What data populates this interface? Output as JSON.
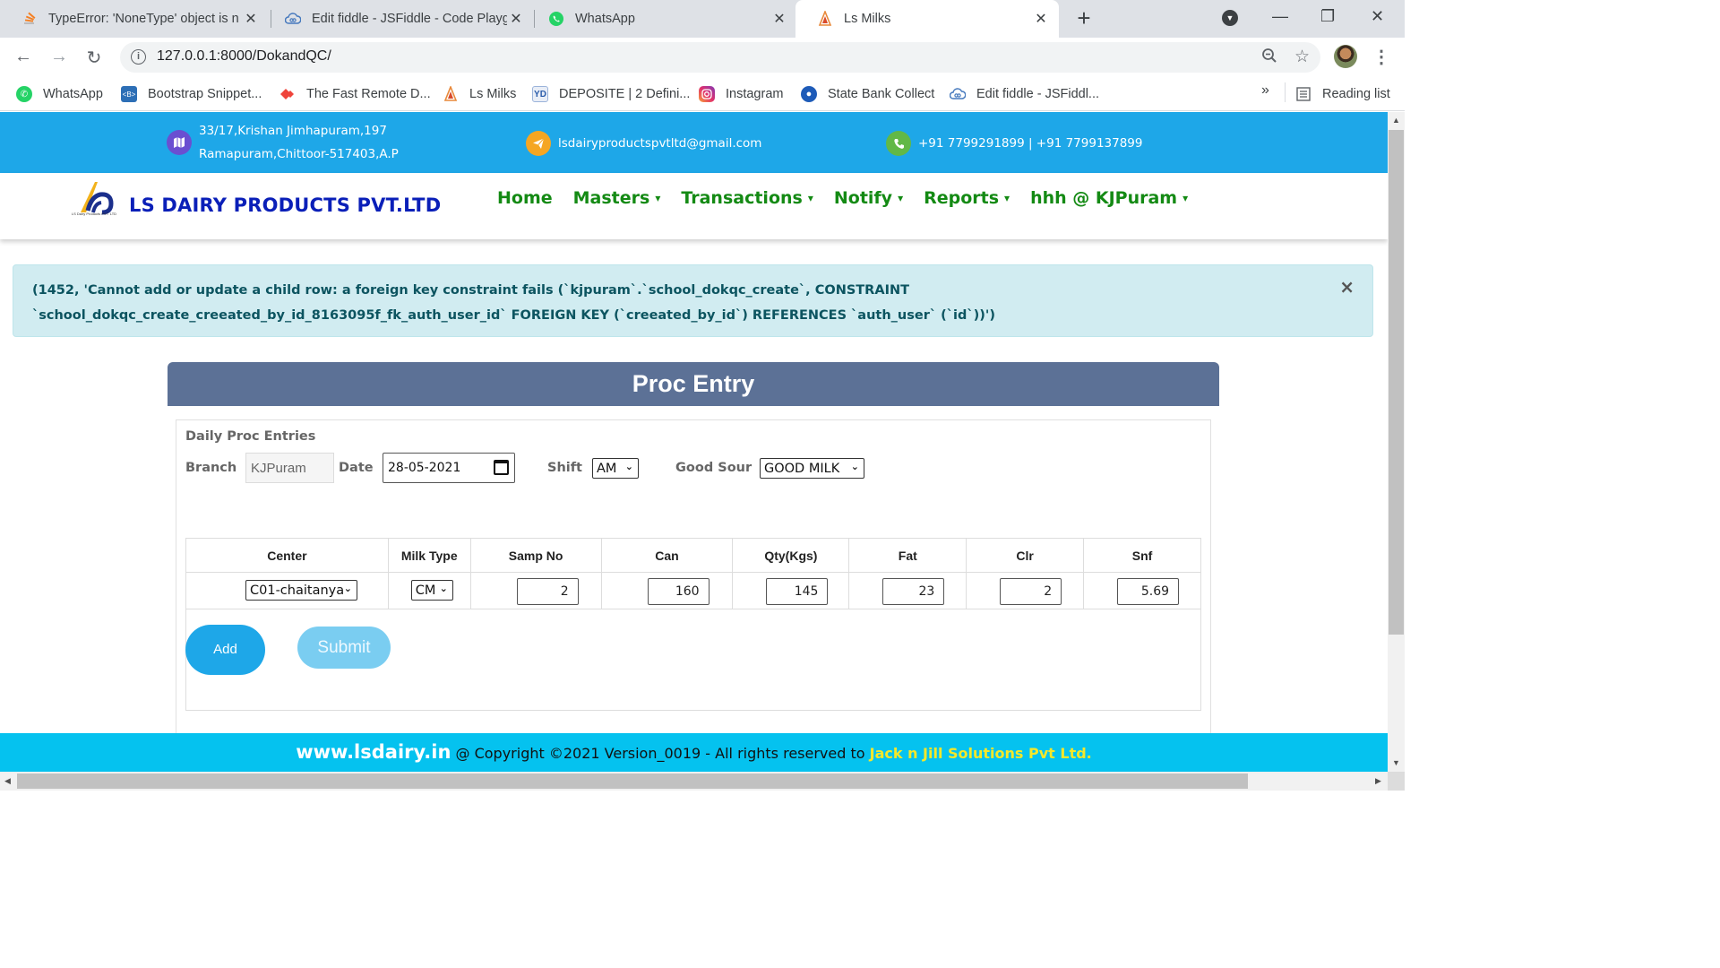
{
  "browser": {
    "tabs": [
      {
        "title": "TypeError: 'NoneType' object is n",
        "icon": "stackoverflow-icon"
      },
      {
        "title": "Edit fiddle - JSFiddle - Code Playg",
        "icon": "jsfiddle-icon"
      },
      {
        "title": "WhatsApp",
        "icon": "whatsapp-icon"
      },
      {
        "title": "Ls Milks",
        "icon": "ls-milks-icon"
      }
    ],
    "close_glyph": "✕",
    "new_tab_glyph": "+",
    "url": "127.0.0.1:8000/DokandQC/",
    "bookmarks": [
      {
        "label": "WhatsApp",
        "icon": "whatsapp-icon"
      },
      {
        "label": "Bootstrap Snippet...",
        "icon": "bootstrap-icon"
      },
      {
        "label": "The Fast Remote D...",
        "icon": "anydesk-icon"
      },
      {
        "label": "Ls Milks",
        "icon": "ls-milks-icon"
      },
      {
        "label": "DEPOSITE | 2 Defini...",
        "icon": "youdao-icon"
      },
      {
        "label": "Instagram",
        "icon": "instagram-icon"
      },
      {
        "label": "State Bank Collect",
        "icon": "sbi-icon"
      },
      {
        "label": "Edit fiddle - JSFiddl...",
        "icon": "jsfiddle-icon"
      }
    ],
    "more_bookmarks": "»",
    "reading_list": "Reading list"
  },
  "contact_bar": {
    "address_line1": "33/17,Krishan Jimhapuram,197",
    "address_line2": "Ramapuram,Chittoor-517403,A.P",
    "email": "lsdairyproductspvtltd@gmail.com",
    "phone": "+91 7799291899 | +91 7799137899"
  },
  "navbar": {
    "brand": "LS DAIRY PRODUCTS PVT.LTD",
    "logo_caption": "LS Dairy Products PVT. LTD",
    "links": [
      {
        "label": "Home",
        "dropdown": false
      },
      {
        "label": "Masters",
        "dropdown": true
      },
      {
        "label": "Transactions",
        "dropdown": true
      },
      {
        "label": "Notify",
        "dropdown": true
      },
      {
        "label": "Reports",
        "dropdown": true
      },
      {
        "label": "hhh @ KJPuram",
        "dropdown": true
      }
    ],
    "caret": "▾"
  },
  "alert": {
    "message": "(1452, 'Cannot add or update a child row: a foreign key constraint fails (`kjpuram`.`school_dokqc_create`, CONSTRAINT `school_dokqc_create_creeated_by_id_8163095f_fk_auth_user_id` FOREIGN KEY (`creeated_by_id`) REFERENCES `auth_user` (`id`))')",
    "close": "×"
  },
  "form": {
    "header": "Proc Entry",
    "section_title": "Daily Proc Entries",
    "branch_label": "Branch",
    "branch_value": "KJPuram",
    "date_label": "Date",
    "date_value": "28-05-2021",
    "shift_label": "Shift",
    "shift_value": "AM",
    "good_sour_label": "Good Sour",
    "good_sour_value": "GOOD MILK",
    "columns": [
      "Center",
      "Milk Type",
      "Samp No",
      "Can",
      "Qty(Kgs)",
      "Fat",
      "Clr",
      "Snf"
    ],
    "row": {
      "center": "C01-chaitanya",
      "milk_type": "CM",
      "samp_no": "2",
      "can": "160",
      "qty": "145",
      "fat": "23",
      "clr": "2",
      "snf": "5.69"
    },
    "add_label": "Add",
    "submit_label": "Submit"
  },
  "footer": {
    "site": "www.lsdairy.in",
    "copyright": " @ Copyright ©2021 Version_0019 - All rights reserved to ",
    "company": "Jack n Jill Solutions Pvt Ltd."
  },
  "colors": {
    "contact_bar": "#1ea7e8",
    "brand": "#0a1fb8",
    "nav_link": "#148a14",
    "proc_header": "#5c7196",
    "footer": "#05c2ef",
    "footer_company": "#f5e82a"
  }
}
